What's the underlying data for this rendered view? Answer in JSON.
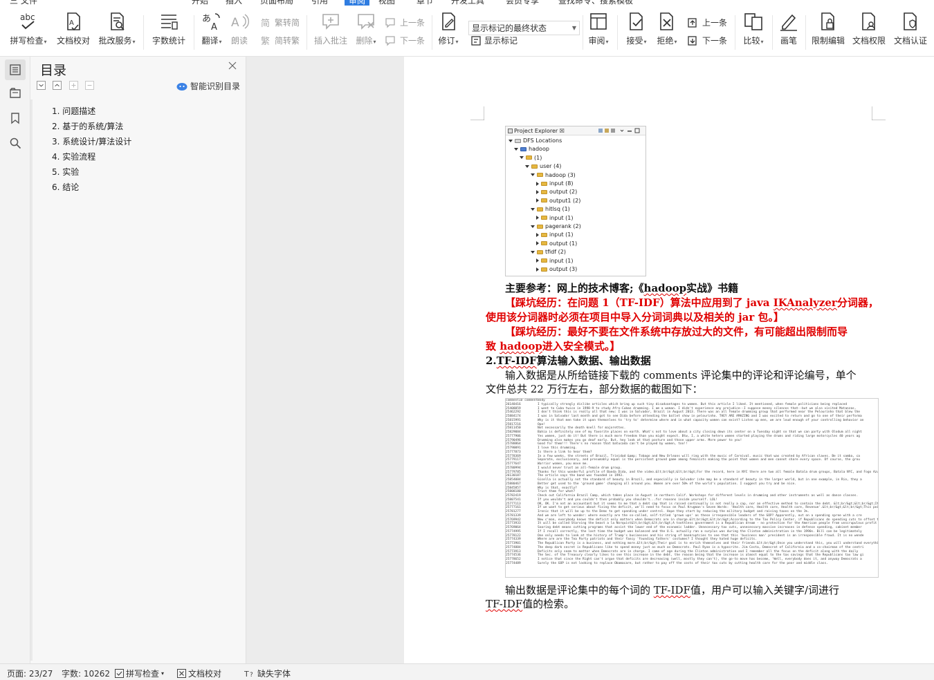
{
  "menubar": {
    "items": [
      "三 文件",
      "开始",
      "插入",
      "页面布局",
      "引用",
      "审阅",
      "视图",
      "章节",
      "开发工具",
      "会员专享",
      "查找命令、搜索模板"
    ],
    "active_index": 5
  },
  "ribbon": {
    "spell_check": "拼写检查",
    "doc_proof": "文档校对",
    "batch_service": "批改服务",
    "word_count": "字数统计",
    "translate": "翻译",
    "read_aloud": "朗读",
    "to_traditional": "繁转简",
    "to_simplified": "简转繁",
    "insert_comment": "插入批注",
    "delete": "删除",
    "prev_comment": "上一条",
    "next_comment": "下一条",
    "markup_display": "显示标记的最终状态",
    "track_changes": "修订",
    "show_markup": "显示标记",
    "review": "审阅",
    "accept": "接受",
    "reject": "拒绝",
    "prev_change": "上一条",
    "next_change": "下一条",
    "compare": "比较",
    "ink": "画笔",
    "restrict_edit": "限制编辑",
    "doc_permission": "文档权限",
    "doc_certify": "文档认证"
  },
  "toc": {
    "title": "目录",
    "smart_label": "智能识别目录",
    "items": [
      "1. 问题描述",
      "2. 基于的系统/算法",
      "3. 系统设计/算法设计",
      "4. 实验流程",
      "5. 实验",
      "6. 结论"
    ]
  },
  "explorer": {
    "tab": "Project Explorer ☒",
    "nodes": [
      {
        "label": "DFS Locations",
        "depth": 0,
        "open": true,
        "icon": "dfs"
      },
      {
        "label": "hadoop",
        "depth": 1,
        "open": true,
        "icon": "elephant"
      },
      {
        "label": "(1)",
        "depth": 2,
        "open": true,
        "icon": "folder"
      },
      {
        "label": "user (4)",
        "depth": 3,
        "open": true,
        "icon": "folder"
      },
      {
        "label": "hadoop (3)",
        "depth": 4,
        "open": true,
        "icon": "folder"
      },
      {
        "label": "input (8)",
        "depth": 5,
        "open": false,
        "icon": "folder"
      },
      {
        "label": "output (2)",
        "depth": 5,
        "open": false,
        "icon": "folder"
      },
      {
        "label": "output1 (2)",
        "depth": 5,
        "open": false,
        "icon": "folder"
      },
      {
        "label": "hitlsq (1)",
        "depth": 4,
        "open": true,
        "icon": "folder"
      },
      {
        "label": "input (1)",
        "depth": 5,
        "open": false,
        "icon": "folder"
      },
      {
        "label": "pagerank (2)",
        "depth": 4,
        "open": true,
        "icon": "folder"
      },
      {
        "label": "input (1)",
        "depth": 5,
        "open": false,
        "icon": "folder"
      },
      {
        "label": "output (1)",
        "depth": 5,
        "open": false,
        "icon": "folder"
      },
      {
        "label": "tfidf (2)",
        "depth": 4,
        "open": true,
        "icon": "folder"
      },
      {
        "label": "input (1)",
        "depth": 5,
        "open": false,
        "icon": "folder"
      },
      {
        "label": "output (3)",
        "depth": 5,
        "open": false,
        "icon": "folder"
      }
    ]
  },
  "doc": {
    "ref_pre": "主要参考：网上的技术博客;《",
    "ref_word": "hadoop",
    "ref_post": "实战》书籍",
    "pit1_l1_pre": "【踩坑经历：在问题 1（TF-IDF）算法中应用到了 java ",
    "pit1_l1_word": "IKAnalyzer",
    "pit1_l1_post": "分词器，",
    "pit1_l2": "使用该分词器时必须在项目中导入分词词典以及相关的 jar 包。】",
    "pit2_l1": "【踩坑经历：最好不要在文件系统中存放过大的文件，有可能超出限制而导",
    "pit2_l2_pre": "致 ",
    "pit2_l2_word": "hadoop",
    "pit2_l2_post": "进入安全模式。】",
    "heading_pre": "2.",
    "heading_word": "TF-IDF",
    "heading_post": "算法输入数据、输出数据",
    "input_l1": "输入数据是从所给链接下载的 comments 评论集中的评论和评论编号，单个",
    "input_l2": "文件总共 22 万行左右，部分数据的截图如下：",
    "output_l1_pre": "输出数据是评论集中的每个词的 ",
    "output_l1_word": "TF-IDF",
    "output_l1_post": "值，用户可以输入关键字/词进行",
    "output_l2_word": "TF-IDF",
    "output_l2_post": "值的检索。"
  },
  "comments": {
    "header": "commentID       commentBody",
    "rows": [
      [
        "26148416",
        "I typically strongly dislike articles which bring up such tiny disadvantages to women. But this article I liked. It mentioned, when female politicians being replaced"
      ],
      [
        "25408059",
        "I went to Cuba twice in 1998-9 to study Afro-Cuban drumming.  I am a woman.  I didn't experience any prejudice--I suppose money silences that--but we also visited Matanzas,"
      ],
      [
        "25462292",
        "I don't think this is really all that new: I was in Salvador, Brazil in August 2013.  There was an all female drumming group that performed near the Pelourinho that blew the"
      ],
      [
        "25884174",
        "I was in Salvador last month and got to see Dida before attending the ballet show in pelourinho. THEY ARE AMAZING and I was excited to return and go to one of their performa"
      ],
      [
        "25815991",
        "Why is it that men take it upon themselves to 'try to' determine where and in what capacity women can exist?  Listen up men, we are loud enough of your controlling behavior an"
      ],
      [
        "25817216",
        "Opa!"
      ],
      [
        "25811450",
        "Not necessarily the death knell for majorettes."
      ],
      [
        "25829084",
        "Bahia is definitely one of my favorite places on earth. What's not to love about a city closing down its center on a Tuesday night so that we can party with Olodum all night"
      ],
      [
        "25777906",
        "Yes women, just do it! But there is much more freedom than you might expect. Btw, I, a white hetero women started playing the drums and riding large motorcycles 40 years ag"
      ],
      [
        "25790496",
        "Drumming also makes you go deaf early.  But, hey look at that posture and those upper arms. More power to you!"
      ],
      [
        "25788864",
        "Good for them!!!  There's no reason that batucada can't be played by women, too!!"
      ],
      [
        "25790091",
        "I love this drumming."
      ],
      [
        "25777873",
        "Is there a link to hear them?"
      ],
      [
        "25778369",
        "In a few weeks, the streets of Brazil, Trinidad &amp; Tobago and New Orleans will ring with the music of Carnival. music that was created by African slaves.  Be it samba, ca"
      ],
      [
        "25779117",
        "Separate, exclusionary, and presumably equal is the persistent ground game among feminists making the point that women and men cannot share every space. Of course, the grou"
      ],
      [
        "25777647",
        "Warrior women, you move me."
      ],
      [
        "25780994",
        "I would never trust an all-female drum group."
      ],
      [
        "25779785",
        "Thanks for this wonderful profile of Banda Dida, and the video.&lt;br/&gt;&lt;br/&gt;For the record, here in NYC there are two all female Batala drum groups, Batala NYC, and Fogo Azul."
      ],
      [
        "26130187",
        "The article says the band was founded in 1993."
      ],
      [
        "25854084",
        "Gisella is actually not the standard of beauty in Brazil, and especially in Salvador (she may be a standard of beauty in the larger world, but in one example, in Rio, they a"
      ],
      [
        "25880467",
        "Better get used to the 'ground game' changing all around you.  Women are over 50% of the world's population.  I suggest you try and be nice."
      ],
      [
        "25845857",
        "Why is that, exactly?"
      ],
      [
        "25808180",
        "Trust them for what?"
      ],
      [
        "25782419",
        "Check out California Brazil Camp, which takes place in August in northern Calif.   Workshops for different levels in drumming and other instruments as well as dance classes."
      ],
      [
        "25807541",
        "If you wouldn't and you couldn't then probably you shouldn't...for reasons inside yourself. LOL!"
      ],
      [
        "25777113",
        "OK, OK.  I'm not an accountant but it seems to me that a debt cap that is raised continually is not really a cap, nor an effective method to contain the debt.  &lt;br/&gt;&lt;br/&gt;Its"
      ],
      [
        "25777161",
        "If we want to get serious about fixing the deficit, we'll need to focus on Paul Krugman's Seven Words:  'Health care, Health care, Health care, Revenue'.&lt;br/&gt;&lt;br/&gt;This point i"
      ],
      [
        "25781277",
        "Ironic that it will be up to the Dems to get spending under control. Hope they start by reducing the military budget and raising taxes on the 1%."
      ],
      [
        "25781339",
        "And we are left to wonder: where exactly are the so-called, self-titled 'grown ups' as these irresponsible leaders of the GOP? Apparently, out on a spending spree with a cre"
      ],
      [
        "25769942",
        "Now c'mon, everybody knows the deficit only matters when Democrats are in charge.&lt;br/&gt;&lt;br/&gt;According to the Tax Policy Center, if Republicans do spending cuts to offset the c"
      ],
      [
        "25773933",
        "It will be called Starving the beast a la Norquist&lt;br/&gt;&lt;br/&gt;A toothless government is a Republican dream - no protection for the American people from unscrupulous profit seeker"
      ],
      [
        "25769064",
        "Soaring debt means cutting programs that assist the lower end of the economic ladder. Unnecessary tax cuts, unnecessary massive increases in defense spending, cabinet member"
      ],
      [
        "25774995",
        "If I recall correctly, the last time the budget was balanced and the U.S. actually ran a surplus was during the Clinton administration in the 1990s. Bill can be legitimately"
      ],
      [
        "25778122",
        "One only needs to look at the history of Trump's businesses and his string of bankruptcies to see that this 'business man' president is an irresponsible fraud. It is no wonde"
      ],
      [
        "25774339",
        "Where are are the Tea Party patriots and their fancy 'founding fathers' costumes?  I thought they hated huge deficits."
      ],
      [
        "25773901",
        "The Republican Party is a business, and nothing more.&lt;br/&gt;Their goal is to enrich themselves and their friends.&lt;br/&gt;Once you understand this, you will understand everything."
      ],
      [
        "25774884",
        "The deep dark secret is Republicans like to spend money just as much as Democrats. Paul Ryan is a hypocrite. Jim Costa, Democrat of California and a co-chairman of the centri"
      ],
      [
        "25773913",
        "Deficits only seem to matter when Democrats are in charge.  I came of age during the Clinton administration and I remember all the focus on the deficit along with the daily"
      ],
      [
        "25774536",
        "The Sec. of the Treasury clearly likes to see this increase in the debt, the reason being that the increase is almost equal to the tax savings that the Republicans tax law gi"
      ],
      [
        "25778652",
        "I notice that since the Right can't argue that deficits are decreasing (well, mostly they can't), the go-to move has become, 'Well, everybody does it, and anyway Democrats a"
      ],
      [
        "25774489",
        "Surely the GOP is not looking to replace Obamacare, but rather to pay off the costs of their tax cuts by cutting health care for the poor and middle class."
      ]
    ]
  },
  "status": {
    "page": "页面: 23/27",
    "words": "字数: 10262",
    "spell": "拼写检查",
    "proof": "文档校对",
    "missing_font": "缺失字体"
  }
}
